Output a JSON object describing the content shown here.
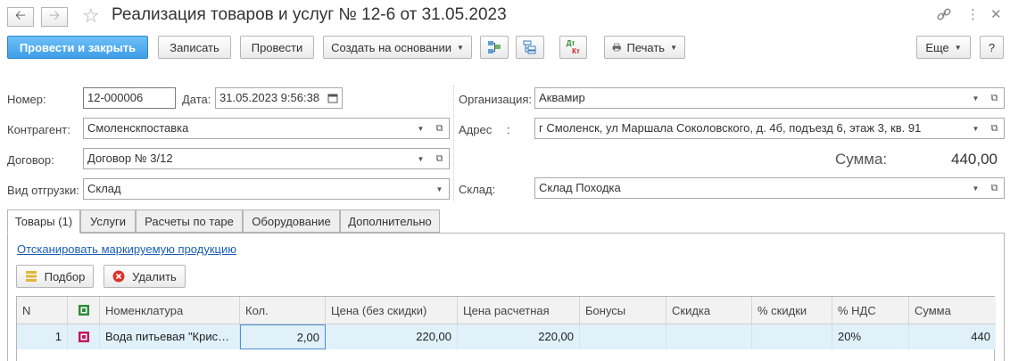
{
  "window": {
    "title": "Реализация товаров и услуг № 12-6 от 31.05.2023"
  },
  "toolbar": {
    "post_close": "Провести и закрыть",
    "write": "Записать",
    "post": "Провести",
    "create_based": "Создать на основании",
    "dt_kt_top": "Дт",
    "dt_kt_bottom": "Кт",
    "print": "Печать",
    "more": "Еще",
    "help": "?"
  },
  "form": {
    "number_label": "Номер:",
    "number_value": "12-000006",
    "date_label": "Дата:",
    "date_value": "31.05.2023  9:56:38",
    "contractor_label": "Контрагент:",
    "contractor_value": "Смоленскпоставка",
    "contract_label": "Договор:",
    "contract_value": "Договор № 3/12",
    "shipment_label": "Вид отгрузки:",
    "shipment_value": "Склад",
    "organization_label": "Организация:",
    "organization_value": "Аквамир",
    "address_label": "Адрес",
    "address_colon": ":",
    "address_value": "г Смоленск,  ул Маршала Соколовского,  д. 4б,  подъезд 6,  этаж 3,  кв. 91",
    "sum_label": "Сумма:",
    "sum_value": "440,00",
    "warehouse_label": "Склад:",
    "warehouse_value": "Склад Походка"
  },
  "tabs": [
    {
      "label": "Товары (1)",
      "active": true
    },
    {
      "label": "Услуги",
      "active": false
    },
    {
      "label": "Расчеты по таре",
      "active": false
    },
    {
      "label": "Оборудование",
      "active": false
    },
    {
      "label": "Дополнительно",
      "active": false
    }
  ],
  "goods": {
    "scan_link": "Отсканировать маркируемую продукцию",
    "select_button": "Подбор",
    "delete_button": "Удалить",
    "columns": [
      "N",
      "",
      "Номенклатура",
      "Кол.",
      "Цена (без скидки)",
      "Цена расчетная",
      "Бонусы",
      "Скидка",
      "% скидки",
      "% НДС",
      "Сумма"
    ],
    "rows": [
      {
        "n": "1",
        "name": "Вода питьевая \"Крис…",
        "qty": "2,00",
        "price": "220,00",
        "calc_price": "220,00",
        "bonus": "",
        "discount": "",
        "discount_pct": "",
        "vat": "20%",
        "sum": "440"
      }
    ]
  },
  "colors": {
    "primary": "#3f9ee8",
    "link": "#1a5fb4",
    "row_selected": "#e0f1f9",
    "delete_icon": "#d9342b"
  }
}
